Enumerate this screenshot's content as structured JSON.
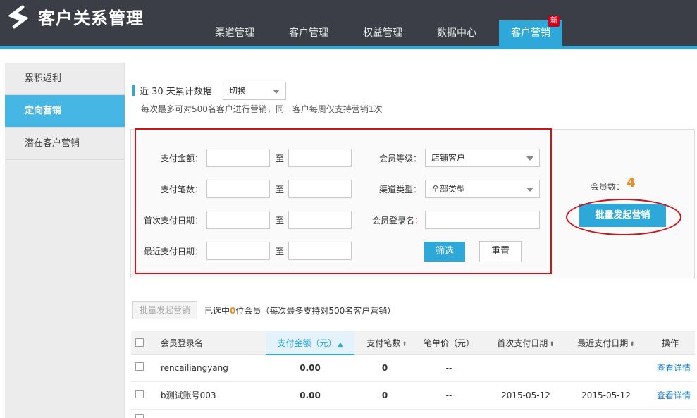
{
  "app": {
    "title": "客户关系管理",
    "logo_icon": "crm-logo-icon"
  },
  "nav": {
    "tabs": [
      {
        "label": "渠道管理"
      },
      {
        "label": "客户管理"
      },
      {
        "label": "权益管理"
      },
      {
        "label": "数据中心"
      },
      {
        "label": "客户营销"
      }
    ],
    "active": "客户营销",
    "new_badge": "新"
  },
  "sidebar": {
    "items": [
      {
        "label": "累积返利"
      },
      {
        "label": "定向营销"
      },
      {
        "label": "潜在客户营销"
      }
    ],
    "active": "定向营销"
  },
  "section": {
    "title": "近 30 天累计数据",
    "switch_select": "切换",
    "note": "每次最多可对500名客户进行营销，同一客户每周仅支持营销1次"
  },
  "filters": {
    "pay_amount_label": "支付金额：",
    "pay_count_label": "支付笔数：",
    "first_pay_date_label": "首次支付日期：",
    "last_pay_date_label": "最近支付日期：",
    "to": "至",
    "member_level_label": "会员等级：",
    "member_level_value": "店铺客户",
    "channel_type_label": "渠道类型：",
    "channel_type_value": "全部类型",
    "login_name_label": "会员登录名",
    "login_name_marker": "：",
    "filter_button": "筛选",
    "reset_button": "重置"
  },
  "summary": {
    "member_count_label": "会员数：",
    "member_count": "4",
    "batch_button": "批量发起营销"
  },
  "selection": {
    "batch_button_disabled": "批量发起营销",
    "prefix": "已选中",
    "count": "0",
    "suffix": "位会员（每次最多支持对500名客户营销）"
  },
  "table": {
    "headers": {
      "login_name": "会员登录名",
      "pay_amount": "支付金额（元）",
      "pay_count": "支付笔数",
      "unit_price": "笔单价（元）",
      "first_pay": "首次支付日期",
      "last_pay": "最近支付日期",
      "action": "操作"
    },
    "rows": [
      {
        "login_name": "rencailiangyang",
        "pay_amount": "0.00",
        "pay_count": "0",
        "unit_price": "--",
        "first_pay": "",
        "last_pay": "",
        "action": "查看详情"
      },
      {
        "login_name": "b测试账号003",
        "pay_amount": "0.00",
        "pay_count": "0",
        "unit_price": "--",
        "first_pay": "2015-05-12",
        "last_pay": "2015-05-12",
        "action": "查看详情"
      }
    ]
  },
  "colors": {
    "accent": "#2ea8d8",
    "header_bg": "#3b3e46",
    "highlight": "#d0121b",
    "count": "#f08a1c"
  }
}
